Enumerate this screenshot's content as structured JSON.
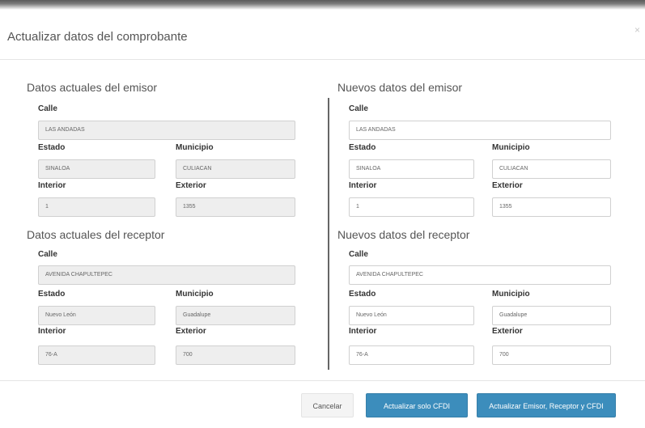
{
  "modal": {
    "title": "Actualizar datos del comprobante",
    "close": "×"
  },
  "labels": {
    "calle": "Calle",
    "estado": "Estado",
    "municipio": "Municipio",
    "interior": "Interior",
    "exterior": "Exterior"
  },
  "current": {
    "emisor_title": "Datos actuales del emisor",
    "receptor_title": "Datos actuales del receptor",
    "emisor": {
      "calle": "LAS ANDADAS",
      "estado": "SINALOA",
      "municipio": "CULIACAN",
      "interior": "1",
      "exterior": "1355"
    },
    "receptor": {
      "calle": "AVENIDA CHAPULTEPEC",
      "estado": "Nuevo León",
      "municipio": "Guadalupe",
      "interior": "76-A",
      "exterior": "700"
    }
  },
  "new": {
    "emisor_title": "Nuevos datos del emisor",
    "receptor_title": "Nuevos datos del receptor",
    "emisor": {
      "calle": "LAS ANDADAS",
      "estado": "SINALOA",
      "municipio": "CULIACAN",
      "interior": "1",
      "exterior": "1355"
    },
    "receptor": {
      "calle": "AVENIDA CHAPULTEPEC",
      "estado": "Nuevo León",
      "municipio": "Guadalupe",
      "interior": "76-A",
      "exterior": "700"
    }
  },
  "footer": {
    "cancel": "Cancelar",
    "update_cfdi": "Actualizar solo CFDI",
    "update_all": "Actualizar Emisor, Receptor y CFDI"
  },
  "colors": {
    "primary": "#3c8dbc",
    "readonly_bg": "#eeeeee"
  }
}
